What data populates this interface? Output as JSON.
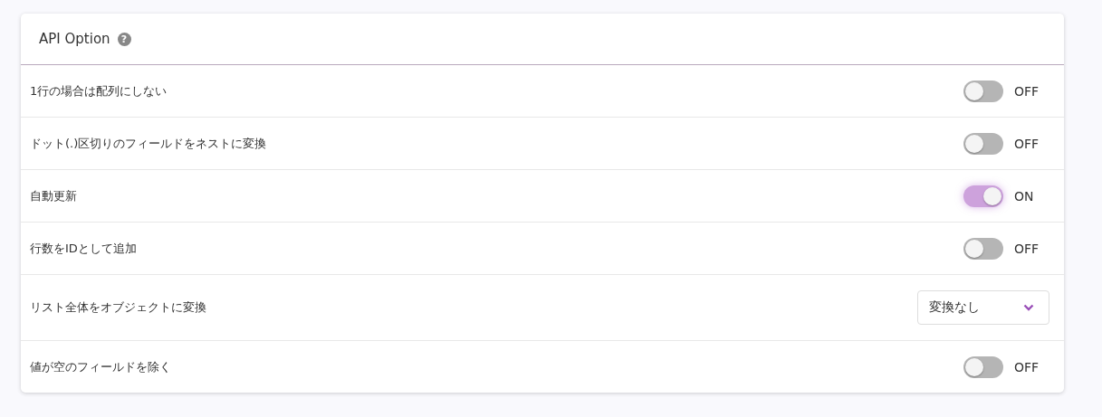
{
  "card": {
    "title": "API Option",
    "help_icon": "?"
  },
  "options": [
    {
      "kind": "toggle",
      "label": "1行の場合は配列にしない",
      "on": false,
      "state_label": "OFF"
    },
    {
      "kind": "toggle",
      "label": "ドット(.)区切りのフィールドをネストに変換",
      "on": false,
      "state_label": "OFF"
    },
    {
      "kind": "toggle",
      "label": "自動更新",
      "on": true,
      "state_label": "ON"
    },
    {
      "kind": "toggle",
      "label": "行数をIDとして追加",
      "on": false,
      "state_label": "OFF"
    },
    {
      "kind": "select",
      "label": "リスト全体をオブジェクトに変換",
      "value": "変換なし"
    },
    {
      "kind": "toggle",
      "label": "値が空のフィールドを除く",
      "on": false,
      "state_label": "OFF"
    }
  ]
}
